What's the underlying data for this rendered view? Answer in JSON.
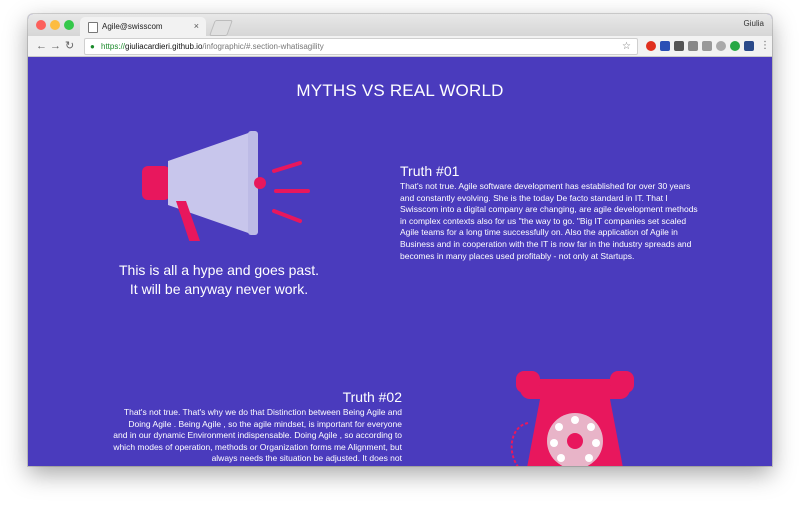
{
  "browser": {
    "tab_title": "Agile@swisscom",
    "tab_close": "×",
    "profile_name": "Giulia",
    "url_scheme": "https://",
    "url_host": "giuliacardieri.github.io",
    "url_path": "/infographic/#.section-whatisagility",
    "nav": {
      "back": "←",
      "forward": "→",
      "reload": "↻"
    },
    "star": "☆",
    "lock": "🔒"
  },
  "page": {
    "heading": "MYTHS VS REAL WORLD",
    "myth1": {
      "line1": "This is all a hype and goes past.",
      "line2": "It will be anyway never work."
    },
    "truth1": {
      "title": "Truth #01",
      "body": "That's not true. Agile software development has established for over 30 years and constantly evolving. She is the today De facto standard in IT. That I Swisscom into a digital company are changing, are agile development methods in complex contexts also for us \"the way to go. \"Big IT companies set scaled Agile teams for a long time successfully on. Also the application of Agile in Business and in cooperation with the IT is now far in the industry spreads and becomes in many places used profitably - not only at Startups."
    },
    "truth2": {
      "title": "Truth #02",
      "body": "That's not true. That's why we do that Distinction between Being Agile and Doing Agile . Being Agile , so the agile mindset, is important for everyone and in our dynamic Environment indispensable. Doing Agile , so according to which modes of operation, methods or Organization forms me Alignment, but always needs the situation be adjusted. It does not"
    }
  },
  "colors": {
    "background": "#4a3bbd",
    "accent": "#e8175d",
    "megaphone_cone": "#c8c6ec"
  }
}
